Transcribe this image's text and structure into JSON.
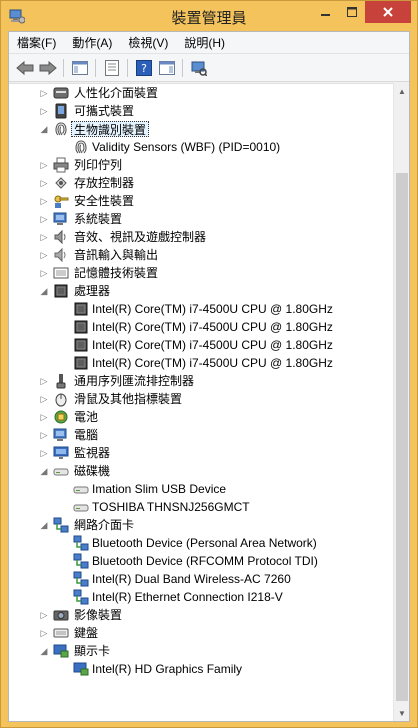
{
  "window": {
    "title": "裝置管理員"
  },
  "menu": [
    "檔案(F)",
    "動作(A)",
    "檢視(V)",
    "說明(H)"
  ],
  "tree": [
    {
      "level": 0,
      "expanded": false,
      "label": "人性化介面裝置",
      "icon": "hid-icon"
    },
    {
      "level": 0,
      "expanded": false,
      "label": "可攜式裝置",
      "icon": "portable-device-icon"
    },
    {
      "level": 0,
      "expanded": true,
      "selected": true,
      "label": "生物識別裝置",
      "icon": "fingerprint-icon"
    },
    {
      "level": 1,
      "label": "Validity Sensors (WBF) (PID=0010)",
      "icon": "fingerprint-icon"
    },
    {
      "level": 0,
      "expanded": false,
      "label": "列印佇列",
      "icon": "printer-icon"
    },
    {
      "level": 0,
      "expanded": false,
      "label": "存放控制器",
      "icon": "storage-controller-icon"
    },
    {
      "level": 0,
      "expanded": false,
      "label": "安全性裝置",
      "icon": "security-key-icon"
    },
    {
      "level": 0,
      "expanded": false,
      "label": "系統裝置",
      "icon": "system-device-icon"
    },
    {
      "level": 0,
      "expanded": false,
      "label": "音效、視訊及遊戲控制器",
      "icon": "speaker-icon"
    },
    {
      "level": 0,
      "expanded": false,
      "label": "音訊輸入與輸出",
      "icon": "audio-io-icon"
    },
    {
      "level": 0,
      "expanded": false,
      "label": "記憶體技術裝置",
      "icon": "memory-icon"
    },
    {
      "level": 0,
      "expanded": true,
      "label": "處理器",
      "icon": "processor-icon"
    },
    {
      "level": 1,
      "label": "Intel(R) Core(TM) i7-4500U CPU @ 1.80GHz",
      "icon": "processor-icon"
    },
    {
      "level": 1,
      "label": "Intel(R) Core(TM) i7-4500U CPU @ 1.80GHz",
      "icon": "processor-icon"
    },
    {
      "level": 1,
      "label": "Intel(R) Core(TM) i7-4500U CPU @ 1.80GHz",
      "icon": "processor-icon"
    },
    {
      "level": 1,
      "label": "Intel(R) Core(TM) i7-4500U CPU @ 1.80GHz",
      "icon": "processor-icon"
    },
    {
      "level": 0,
      "expanded": false,
      "label": "通用序列匯流排控制器",
      "icon": "usb-icon"
    },
    {
      "level": 0,
      "expanded": false,
      "label": "滑鼠及其他指標裝置",
      "icon": "mouse-icon"
    },
    {
      "level": 0,
      "expanded": false,
      "label": "電池",
      "icon": "battery-icon"
    },
    {
      "level": 0,
      "expanded": false,
      "label": "電腦",
      "icon": "computer-icon"
    },
    {
      "level": 0,
      "expanded": false,
      "label": "監視器",
      "icon": "monitor-icon"
    },
    {
      "level": 0,
      "expanded": true,
      "label": "磁碟機",
      "icon": "disk-drive-icon"
    },
    {
      "level": 1,
      "label": "Imation Slim USB Device",
      "icon": "disk-drive-icon"
    },
    {
      "level": 1,
      "label": "TOSHIBA THNSNJ256GMCT",
      "icon": "disk-drive-icon"
    },
    {
      "level": 0,
      "expanded": true,
      "label": "網路介面卡",
      "icon": "network-adapter-icon"
    },
    {
      "level": 1,
      "label": "Bluetooth Device (Personal Area Network)",
      "icon": "network-adapter-icon"
    },
    {
      "level": 1,
      "label": "Bluetooth Device (RFCOMM Protocol TDI)",
      "icon": "network-adapter-icon"
    },
    {
      "level": 1,
      "label": "Intel(R) Dual Band Wireless-AC 7260",
      "icon": "network-adapter-icon"
    },
    {
      "level": 1,
      "label": "Intel(R) Ethernet Connection I218-V",
      "icon": "network-adapter-icon"
    },
    {
      "level": 0,
      "expanded": false,
      "label": "影像裝置",
      "icon": "camera-icon"
    },
    {
      "level": 0,
      "expanded": false,
      "label": "鍵盤",
      "icon": "keyboard-icon"
    },
    {
      "level": 0,
      "expanded": true,
      "label": "顯示卡",
      "icon": "display-adapter-icon"
    },
    {
      "level": 1,
      "label": "Intel(R) HD Graphics Family",
      "icon": "display-adapter-icon"
    }
  ]
}
